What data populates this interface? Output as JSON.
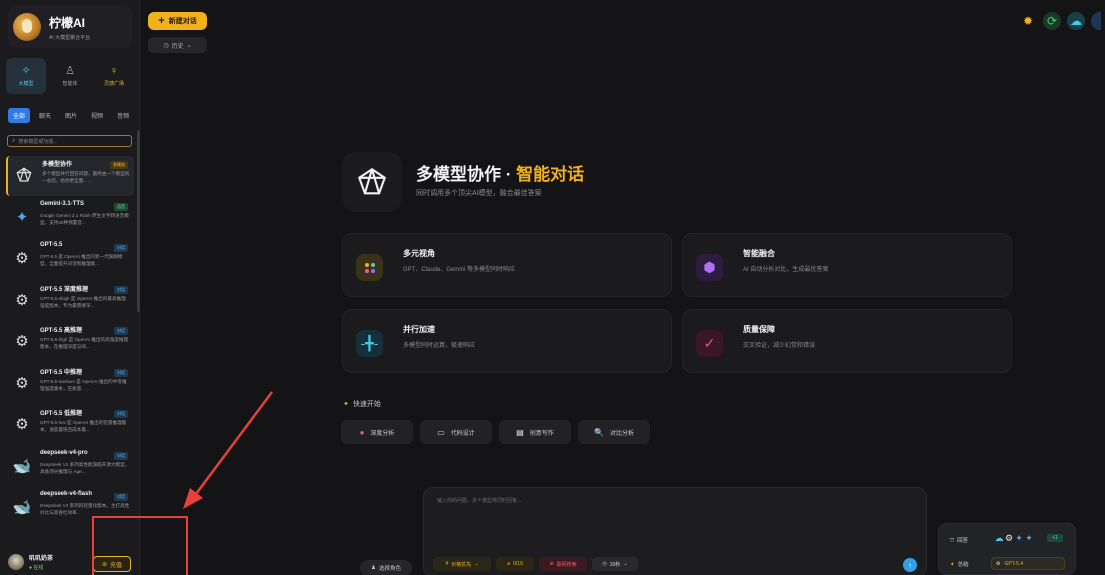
{
  "brand": {
    "name": "柠檬AI",
    "subtitle": "AI 大模型聚合平台"
  },
  "nav": [
    {
      "label": "大模型",
      "icon": "sparkle-icon"
    },
    {
      "label": "智能体",
      "icon": "person-icon"
    },
    {
      "label": "灵感广场",
      "icon": "bulb-icon"
    }
  ],
  "filters": [
    "全部",
    "聊天",
    "图片",
    "视频",
    "音频"
  ],
  "search": {
    "placeholder": "搜索模型或功能..."
  },
  "models": [
    {
      "name": "多模型协作",
      "badge": "多模态",
      "desc": "多个模型并行回答问题，最终由一个模型统一总结，给你更全面、...",
      "icon": "multi-model-icon"
    },
    {
      "name": "Gemini-3.1-TTS",
      "badge": "语音",
      "desc": "Google Gemini 3.1 Flash 原生文字转语音模型，支持30种预置音...",
      "icon": "gemini-icon"
    },
    {
      "name": "GPT-5.5",
      "badge": "对话",
      "desc": "GPT-5.5 是 OpenAI 推出的新一代旗舰模型，全面提升对话和推理能...",
      "icon": "openai-icon"
    },
    {
      "name": "GPT-5.5 深度推理",
      "badge": "对话",
      "desc": "GPT-5.5-xhigh 是 OpenAI 推出的最高推理强度版本，专为最需要深...",
      "icon": "openai-icon"
    },
    {
      "name": "GPT-5.5 高推理",
      "badge": "对话",
      "desc": "GPT-5.5-high 是 OpenAI 推出的高强度推理版本，在推理深度与响...",
      "icon": "openai-icon"
    },
    {
      "name": "GPT-5.5 中推理",
      "badge": "对话",
      "desc": "GPT-5.5-medium 是 OpenAI 推出的中等推理强度版本，在质量、...",
      "icon": "openai-icon"
    },
    {
      "name": "GPT-5.5 低推理",
      "badge": "对话",
      "desc": "GPT-5.5-low 是 OpenAI 推出的轻量推理版本，速度最快且成本最...",
      "icon": "openai-icon"
    },
    {
      "name": "deepseek-v4-pro",
      "badge": "对话",
      "desc": "DeepSeek V4 系列高性能旗舰开源大模型，具备顶尖推理与 Age...",
      "icon": "deepseek-icon"
    },
    {
      "name": "deepseek-v4-flash",
      "badge": "对话",
      "desc": "DeepSeek V4 系列的轻量化版本，主打高性价比与高吞吐效率...",
      "icon": "deepseek-icon"
    }
  ],
  "user": {
    "name": "叽叽奶茶",
    "status": "在线",
    "recharge": "充值"
  },
  "top": {
    "new_chat": "新建对话",
    "history": "历史"
  },
  "hero": {
    "title_main": "多模型协作 · ",
    "title_highlight": "智能对话",
    "subtitle": "同时调用多个顶尖AI模型，融合最佳答案"
  },
  "cards": [
    {
      "title": "多元视角",
      "desc": "GPT、Claude、Gemini 等多模型同时响应"
    },
    {
      "title": "智能融合",
      "desc": "AI 自动分析对比，生成最优答案"
    },
    {
      "title": "并行加速",
      "desc": "多模型同时运算，极速响应"
    },
    {
      "title": "质量保障",
      "desc": "交叉验证，减少幻觉和错误"
    }
  ],
  "quick": {
    "title": "快速开始",
    "buttons": [
      "深度分析",
      "代码设计",
      "创意写作",
      "对比分析"
    ]
  },
  "input": {
    "placeholder": "输入你的问题，多个模型将同时回答...",
    "role_button": "选择角色",
    "chips": [
      "价格优先",
      "0/10",
      "联网搜索",
      "30秒"
    ]
  },
  "panel": {
    "answer_label": "回答",
    "summary_label": "总结",
    "plus_badge": "+1",
    "summary_model": "GPT-5.4"
  },
  "colors": {
    "accent": "#f0b21a",
    "annotation": "#e8403a",
    "active_blue": "#2f7be6"
  }
}
